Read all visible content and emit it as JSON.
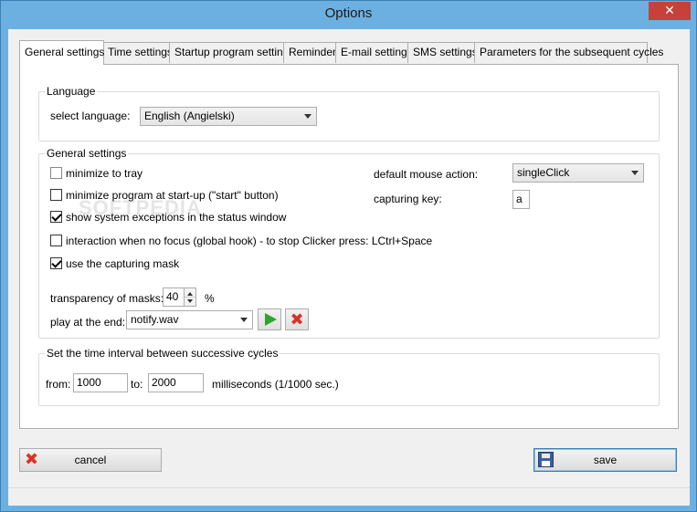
{
  "window": {
    "title": "Options",
    "close_glyph": "✕"
  },
  "tabs": [
    {
      "label": "General settings"
    },
    {
      "label": "Time settings"
    },
    {
      "label": "Startup program settings"
    },
    {
      "label": "Reminder"
    },
    {
      "label": "E-mail settings"
    },
    {
      "label": "SMS settings"
    },
    {
      "label": "Parameters for the subsequent cycles"
    }
  ],
  "language": {
    "group_label": "Language",
    "select_label": "select language:",
    "selected": "English (Angielski)"
  },
  "general": {
    "group_label": "General settings",
    "checkboxes": [
      {
        "label": "minimize to tray",
        "checked": false
      },
      {
        "label": "minimize program at start-up (\"start\" button)",
        "checked": false
      },
      {
        "label": "show system exceptions in the status window",
        "checked": true
      },
      {
        "label": "interaction when no focus (global hook) - to stop Clicker press: LCtrl+Space",
        "checked": false
      },
      {
        "label": "use the capturing mask",
        "checked": true
      }
    ],
    "mouse_action_label": "default mouse action:",
    "mouse_action_value": "singleClick",
    "capturing_key_label": "capturing key:",
    "capturing_key_value": "a",
    "transparency_label": "transparency of masks:",
    "transparency_value": "40",
    "transparency_unit": "%",
    "play_label": "play at the end:",
    "play_value": "notify.wav"
  },
  "interval": {
    "group_label": "Set the time interval between successive cycles",
    "from_label": "from:",
    "from_value": "1000",
    "to_label": "to:",
    "to_value": "2000",
    "unit_label": "milliseconds (1/1000 sec.)"
  },
  "buttons": {
    "cancel": "cancel",
    "save": "save"
  },
  "watermark": "SOFTPEDIA"
}
